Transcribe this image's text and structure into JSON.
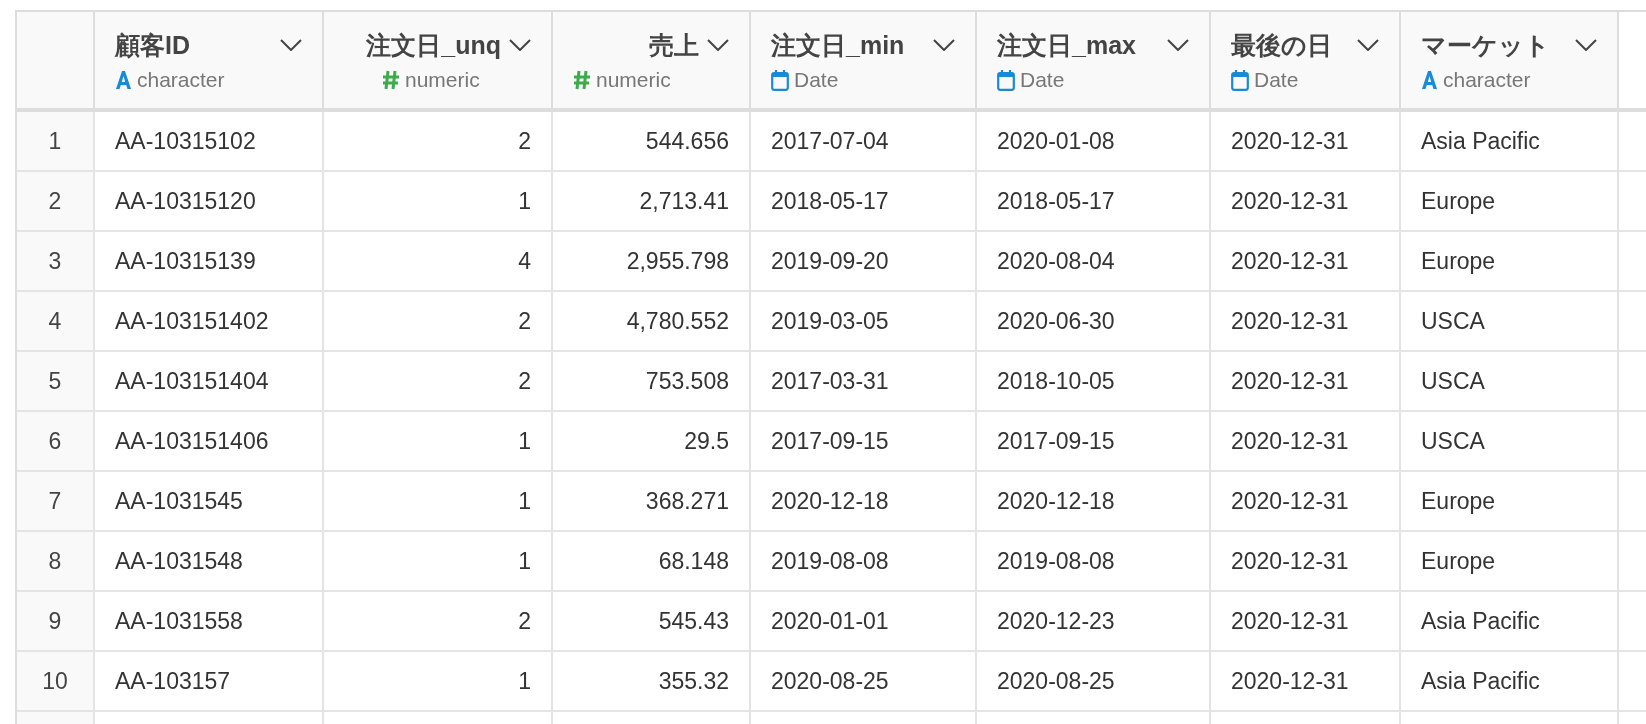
{
  "table": {
    "columns": [
      {
        "title": "顧客ID",
        "type_label": "character",
        "kind": "text"
      },
      {
        "title": "注文日_unq",
        "type_label": "numeric",
        "kind": "number"
      },
      {
        "title": "売上",
        "type_label": "numeric",
        "kind": "number"
      },
      {
        "title": "注文日_min",
        "type_label": "Date",
        "kind": "date"
      },
      {
        "title": "注文日_max",
        "type_label": "Date",
        "kind": "date"
      },
      {
        "title": "最後の日",
        "type_label": "Date",
        "kind": "date"
      },
      {
        "title": "マーケット",
        "type_label": "character",
        "kind": "text"
      }
    ],
    "rows": [
      {
        "number": "1",
        "cells": [
          "AA-10315102",
          "2",
          "544.656",
          "2017-07-04",
          "2020-01-08",
          "2020-12-31",
          "Asia Pacific"
        ]
      },
      {
        "number": "2",
        "cells": [
          "AA-10315120",
          "1",
          "2,713.41",
          "2018-05-17",
          "2018-05-17",
          "2020-12-31",
          "Europe"
        ]
      },
      {
        "number": "3",
        "cells": [
          "AA-10315139",
          "4",
          "2,955.798",
          "2019-09-20",
          "2020-08-04",
          "2020-12-31",
          "Europe"
        ]
      },
      {
        "number": "4",
        "cells": [
          "AA-103151402",
          "2",
          "4,780.552",
          "2019-03-05",
          "2020-06-30",
          "2020-12-31",
          "USCA"
        ]
      },
      {
        "number": "5",
        "cells": [
          "AA-103151404",
          "2",
          "753.508",
          "2017-03-31",
          "2018-10-05",
          "2020-12-31",
          "USCA"
        ]
      },
      {
        "number": "6",
        "cells": [
          "AA-103151406",
          "1",
          "29.5",
          "2017-09-15",
          "2017-09-15",
          "2020-12-31",
          "USCA"
        ]
      },
      {
        "number": "7",
        "cells": [
          "AA-1031545",
          "1",
          "368.271",
          "2020-12-18",
          "2020-12-18",
          "2020-12-31",
          "Europe"
        ]
      },
      {
        "number": "8",
        "cells": [
          "AA-1031548",
          "1",
          "68.148",
          "2019-08-08",
          "2019-08-08",
          "2020-12-31",
          "Europe"
        ]
      },
      {
        "number": "9",
        "cells": [
          "AA-1031558",
          "2",
          "545.43",
          "2020-01-01",
          "2020-12-23",
          "2020-12-31",
          "Asia Pacific"
        ]
      },
      {
        "number": "10",
        "cells": [
          "AA-103157",
          "1",
          "355.32",
          "2020-08-25",
          "2020-08-25",
          "2020-12-31",
          "Asia Pacific"
        ]
      }
    ]
  }
}
